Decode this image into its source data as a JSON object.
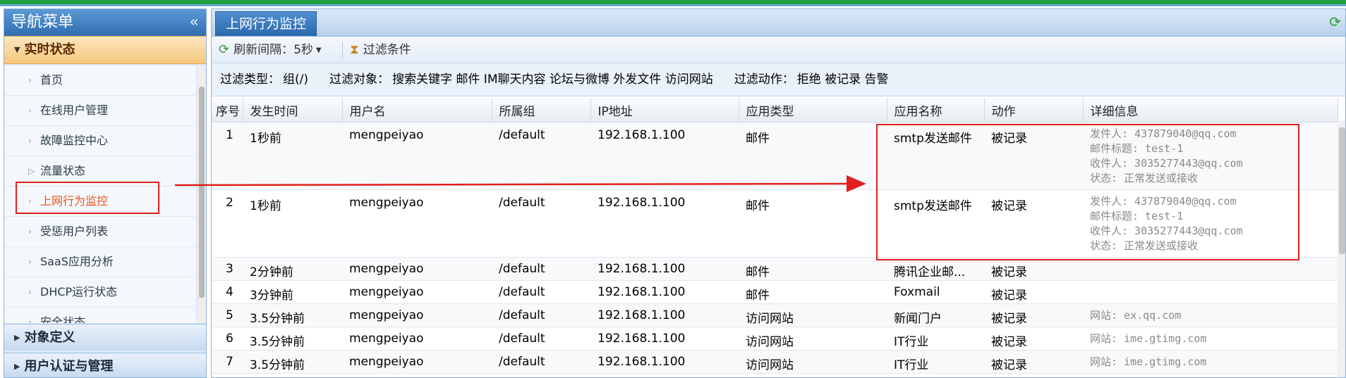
{
  "nav": {
    "title": "导航菜单",
    "collapse_glyph": "«",
    "groups": {
      "realtime": "实时状态",
      "object": "对象定义",
      "auth": "用户认证与管理"
    },
    "items": [
      {
        "label": "首页"
      },
      {
        "label": "在线用户管理"
      },
      {
        "label": "故障监控中心"
      },
      {
        "label": "流量状态"
      },
      {
        "label": "上网行为监控"
      },
      {
        "label": "受惩用户列表"
      },
      {
        "label": "SaaS应用分析"
      },
      {
        "label": "DHCP运行状态"
      },
      {
        "label": "安全状态"
      }
    ]
  },
  "tab": {
    "active": "上网行为监控"
  },
  "toolbar": {
    "refresh": "刷新间隔：5秒",
    "filter": "过滤条件"
  },
  "filter": {
    "type_label": "过滤类型：",
    "type_value": "组(/)",
    "object_label": "过滤对象：",
    "object_value": "搜索关键字 邮件 IM聊天内容 论坛与微博 外发文件 访问网站",
    "action_label": "过滤动作：",
    "action_value": "拒绝 被记录 告警"
  },
  "table": {
    "columns": [
      "序号",
      "发生时间",
      "用户名",
      "所属组",
      "IP地址",
      "应用类型",
      "应用名称",
      "动作",
      "详细信息"
    ],
    "rows": [
      {
        "no": "1",
        "time": "1秒前",
        "user": "mengpeiyao",
        "group": "/default",
        "ip": "192.168.1.100",
        "type": "邮件",
        "app": "smtp发送邮件",
        "action": "被记录",
        "d1": "发件人: 437879040@qq.com",
        "d2": "邮件标题: test-1",
        "d3": "收件人: 3035277443@qq.com",
        "d4": "状态: 正常发送或接收"
      },
      {
        "no": "2",
        "time": "1秒前",
        "user": "mengpeiyao",
        "group": "/default",
        "ip": "192.168.1.100",
        "type": "邮件",
        "app": "smtp发送邮件",
        "action": "被记录",
        "d1": "发件人: 437879040@qq.com",
        "d2": "邮件标题: test-1",
        "d3": "收件人: 3035277443@qq.com",
        "d4": "状态: 正常发送或接收"
      },
      {
        "no": "3",
        "time": "2分钟前",
        "user": "mengpeiyao",
        "group": "/default",
        "ip": "192.168.1.100",
        "type": "邮件",
        "app": "腾讯企业邮...",
        "action": "被记录",
        "d1": ""
      },
      {
        "no": "4",
        "time": "3分钟前",
        "user": "mengpeiyao",
        "group": "/default",
        "ip": "192.168.1.100",
        "type": "邮件",
        "app": "Foxmail",
        "action": "被记录",
        "d1": ""
      },
      {
        "no": "5",
        "time": "3.5分钟前",
        "user": "mengpeiyao",
        "group": "/default",
        "ip": "192.168.1.100",
        "type": "访问网站",
        "app": "新闻门户",
        "action": "被记录",
        "d1": "网站: ex.qq.com"
      },
      {
        "no": "6",
        "time": "3.5分钟前",
        "user": "mengpeiyao",
        "group": "/default",
        "ip": "192.168.1.100",
        "type": "访问网站",
        "app": "IT行业",
        "action": "被记录",
        "d1": "网站: ime.gtimg.com"
      },
      {
        "no": "7",
        "time": "3.5分钟前",
        "user": "mengpeiyao",
        "group": "/default",
        "ip": "192.168.1.100",
        "type": "访问网站",
        "app": "IT行业",
        "action": "被记录",
        "d1": "网站: ime.gtimg.com"
      }
    ]
  },
  "colors": {
    "highlight_red": "#e0201c",
    "accent_blue": "#2f6db0",
    "active_orange": "#e8541a"
  }
}
